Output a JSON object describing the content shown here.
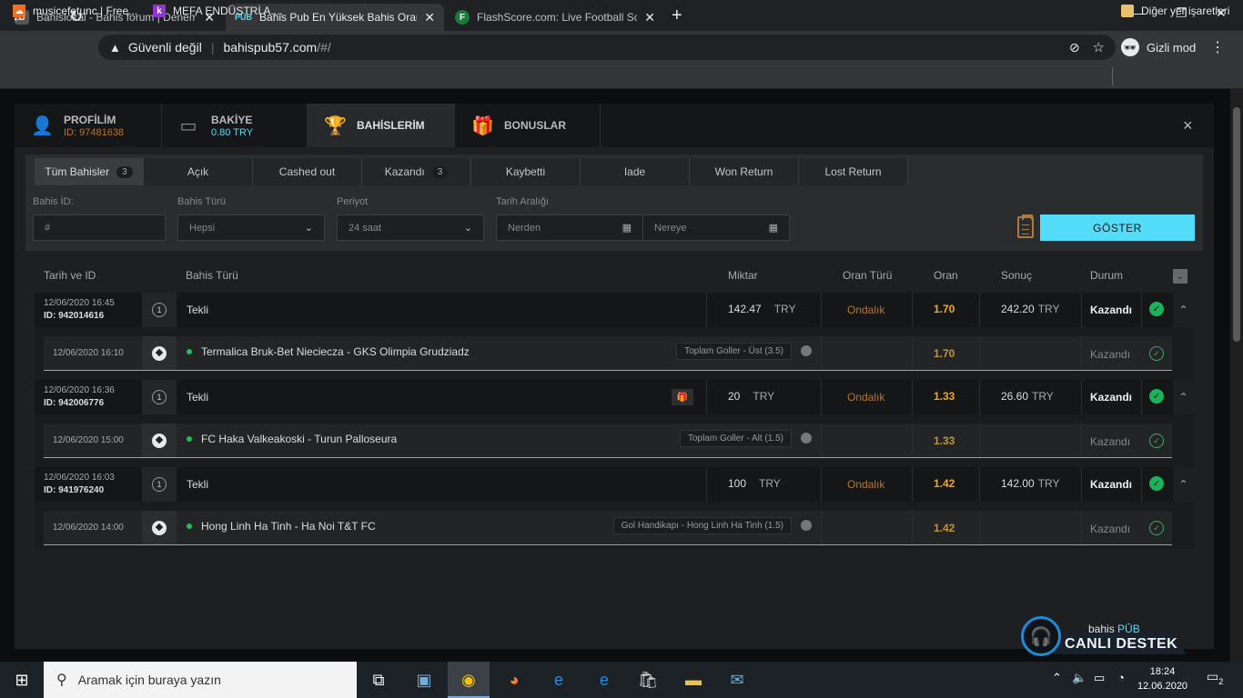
{
  "browser": {
    "tabs": [
      {
        "title": "Bahislokal - Bahis forum | Denem",
        "fav": "B",
        "active": false
      },
      {
        "title": "Bahis Pub En Yüksek Bahis Oranl",
        "fav": "PŪB",
        "active": true
      },
      {
        "title": "FlashScore.com: Live Football Sco",
        "fav": "F",
        "active": false
      }
    ],
    "new_tab": "+",
    "address_warning": "Güvenli değil",
    "url_host": "bahispub57.com",
    "url_path": "/#/",
    "incognito": "Gizli mod",
    "bookmarks": [
      {
        "label": "musicefetunc | Free..."
      },
      {
        "label": "MEFA ENDÜSTRİ A...."
      }
    ],
    "other_bookmarks": "Diğer yer işaretleri"
  },
  "modal": {
    "tabs": [
      {
        "label": "PROFİLİM",
        "sub": "ID: 97481638",
        "icon": "user-icon"
      },
      {
        "label": "BAKİYE",
        "sub": "0.80 TRY",
        "icon": "wallet-icon"
      },
      {
        "label": "BAHİSLERİM",
        "sub": "",
        "icon": "trophy-icon"
      },
      {
        "label": "BONUSLAR",
        "sub": "",
        "icon": "gift-icon"
      }
    ],
    "close": "×"
  },
  "status_tabs": [
    {
      "label": "Tüm Bahisler",
      "count": "3"
    },
    {
      "label": "Açık",
      "count": ""
    },
    {
      "label": "Cashed out",
      "count": ""
    },
    {
      "label": "Kazandı",
      "count": "3"
    },
    {
      "label": "Kaybetti",
      "count": ""
    },
    {
      "label": "Iade",
      "count": ""
    },
    {
      "label": "Won Return",
      "count": ""
    },
    {
      "label": "Lost Return",
      "count": ""
    }
  ],
  "filters": {
    "bet_id_label": "Bahis İD:",
    "bet_id_placeholder": "#",
    "type_label": "Bahis Türü",
    "type_value": "Hepsi",
    "period_label": "Periyot",
    "period_value": "24 saat",
    "range_label": "Tarih Aralığı",
    "from_placeholder": "Nerden",
    "to_placeholder": "Nereye",
    "show_button": "GÖSTER"
  },
  "table": {
    "headers": {
      "date_id": "Tarih ve ID",
      "type": "Bahis Türü",
      "amount": "Miktar",
      "odds_type": "Oran Türü",
      "odds": "Oran",
      "result": "Sonuç",
      "status": "Durum"
    },
    "bets": [
      {
        "date": "12/06/2020 16:45",
        "id": "ID: 942014616",
        "kind": "Tekli",
        "amount": "142.47",
        "currency": "TRY",
        "odds_type": "Ondalık",
        "odds": "1.70",
        "result": "242.20",
        "result_currency": "TRY",
        "status": "Kazandı",
        "gift": false,
        "selection": {
          "date": "12/06/2020 16:10",
          "match": "Termalica Bruk-Bet Nieciecza - GKS Olimpia Grudziadz",
          "market": "Toplam Goller - Üst (3.5)",
          "odds": "1.70",
          "status": "Kazandı"
        }
      },
      {
        "date": "12/06/2020 16:36",
        "id": "ID: 942006776",
        "kind": "Tekli",
        "amount": "20",
        "currency": "TRY",
        "odds_type": "Ondalık",
        "odds": "1.33",
        "result": "26.60",
        "result_currency": "TRY",
        "status": "Kazandı",
        "gift": true,
        "selection": {
          "date": "12/06/2020 15:00",
          "match": "FC Haka Valkeakoski - Turun Palloseura",
          "market": "Toplam Goller - Alt (1.5)",
          "odds": "1.33",
          "status": "Kazandı"
        }
      },
      {
        "date": "12/06/2020 16:03",
        "id": "ID: 941976240",
        "kind": "Tekli",
        "amount": "100",
        "currency": "TRY",
        "odds_type": "Ondalık",
        "odds": "1.42",
        "result": "142.00",
        "result_currency": "TRY",
        "status": "Kazandı",
        "gift": false,
        "selection": {
          "date": "12/06/2020 14:00",
          "match": "Hong Linh Ha Tinh - Ha Noi T&T FC",
          "market": "Gol Handikapı - Hong Linh Ha Tinh (1.5)",
          "odds": "1.42",
          "status": "Kazandı"
        }
      }
    ]
  },
  "chat": {
    "brand": "bahis",
    "brand_accent": "PŪB",
    "label": "CANLI DESTEK"
  },
  "taskbar": {
    "search_placeholder": "Aramak için buraya yazın",
    "time": "18:24",
    "date": "12.06.2020",
    "notifications": "2"
  }
}
